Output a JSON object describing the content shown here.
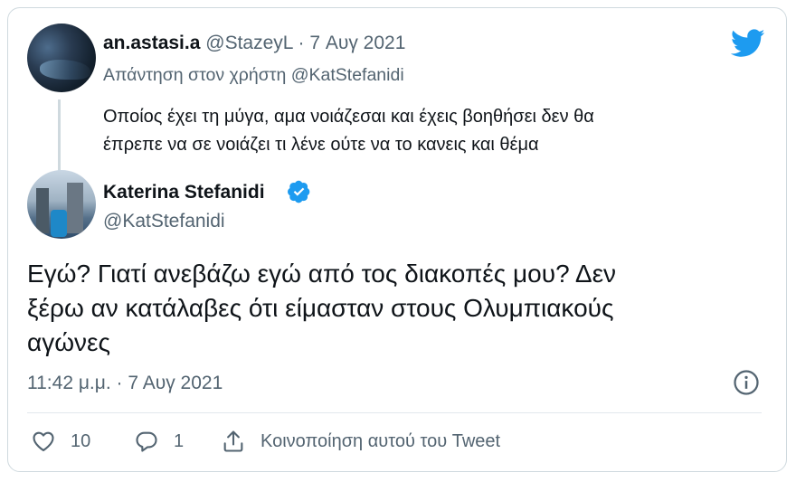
{
  "reply": {
    "name": "an.astasi.a",
    "handle": "@StazeyL",
    "separator": " · ",
    "date": "7 Αυγ 2021",
    "replying_prefix": "Απάντηση στον χρήστη ",
    "replying_to": "@KatStefanidi",
    "text_line1": "Οποίος έχει τη μύγα, αμα νοιάζεσαι και έχεις βοηθήσει δεν θα",
    "text_line2": "έπρεπε να σε νοιάζει τι λένε ούτε να το κανεις και θέμα"
  },
  "tweet": {
    "name": "Katerina Stefanidi",
    "handle": "@KatStefanidi",
    "verified": true,
    "text_line1": "Εγώ? Γιατί ανεβάζω εγώ από τος διακοπές μου? Δεν",
    "text_line2": "ξέρω αν κατάλαβες ότι είμασταν στους Ολυμπιακούς",
    "text_line3": "αγώνες",
    "timestamp": "11:42 μ.μ. · 7 Αυγ 2021"
  },
  "actions": {
    "likes": "10",
    "replies": "1",
    "share_label": "Κοινοποίηση αυτού του Tweet"
  },
  "colors": {
    "brand_blue": "#1d9bf0",
    "text_primary": "#0f1419",
    "text_secondary": "#536471",
    "border": "#cfd9de"
  },
  "icons": [
    "twitter-bird-icon",
    "verified-badge-icon",
    "info-icon",
    "heart-icon",
    "reply-bubble-icon",
    "share-icon"
  ]
}
